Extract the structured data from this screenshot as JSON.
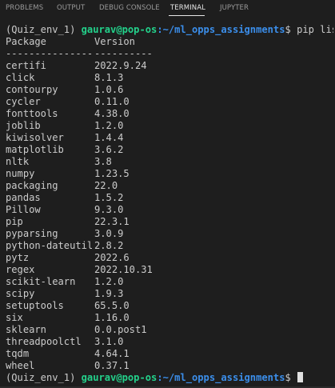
{
  "tabs": [
    {
      "label": "PROBLEMS"
    },
    {
      "label": "OUTPUT"
    },
    {
      "label": "DEBUG CONSOLE"
    },
    {
      "label": "TERMINAL"
    },
    {
      "label": "JUPYTER"
    }
  ],
  "active_tab": "TERMINAL",
  "prompt": {
    "env": "(Quiz_env_1) ",
    "user_host": "gaurav@pop-os",
    "path": ":~/ml_opps_assignments",
    "symbol": "$ ",
    "command": "pip list"
  },
  "headers": {
    "name": "Package",
    "version": "Version",
    "sep_name": "---------------",
    "sep_version": "----------"
  },
  "packages": [
    {
      "name": "certifi",
      "version": "2022.9.24"
    },
    {
      "name": "click",
      "version": "8.1.3"
    },
    {
      "name": "contourpy",
      "version": "1.0.6"
    },
    {
      "name": "cycler",
      "version": "0.11.0"
    },
    {
      "name": "fonttools",
      "version": "4.38.0"
    },
    {
      "name": "joblib",
      "version": "1.2.0"
    },
    {
      "name": "kiwisolver",
      "version": "1.4.4"
    },
    {
      "name": "matplotlib",
      "version": "3.6.2"
    },
    {
      "name": "nltk",
      "version": "3.8"
    },
    {
      "name": "numpy",
      "version": "1.23.5"
    },
    {
      "name": "packaging",
      "version": "22.0"
    },
    {
      "name": "pandas",
      "version": "1.5.2"
    },
    {
      "name": "Pillow",
      "version": "9.3.0"
    },
    {
      "name": "pip",
      "version": "22.3.1"
    },
    {
      "name": "pyparsing",
      "version": "3.0.9"
    },
    {
      "name": "python-dateutil",
      "version": "2.8.2"
    },
    {
      "name": "pytz",
      "version": "2022.6"
    },
    {
      "name": "regex",
      "version": "2022.10.31"
    },
    {
      "name": "scikit-learn",
      "version": "1.2.0"
    },
    {
      "name": "scipy",
      "version": "1.9.3"
    },
    {
      "name": "setuptools",
      "version": "65.5.0"
    },
    {
      "name": "six",
      "version": "1.16.0"
    },
    {
      "name": "sklearn",
      "version": "0.0.post1"
    },
    {
      "name": "threadpoolctl",
      "version": "3.1.0"
    },
    {
      "name": "tqdm",
      "version": "4.64.1"
    },
    {
      "name": "wheel",
      "version": "0.37.1"
    }
  ],
  "colors": {
    "background": "#1e1e1e",
    "text": "#cccccc",
    "user_host": "#23d18b",
    "path": "#3b8eea",
    "active_tab": "#e7e7e7",
    "inactive_tab": "#9a9a9a"
  }
}
